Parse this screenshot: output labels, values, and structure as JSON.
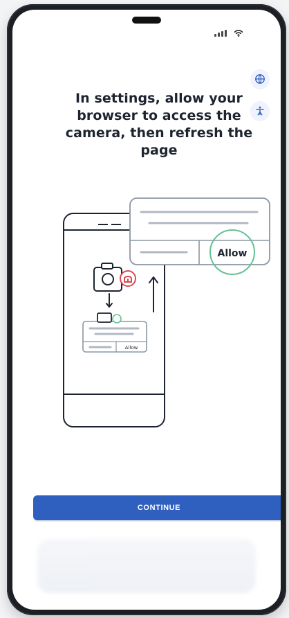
{
  "title": "In settings, allow your browser to access the camera, then refresh the page",
  "dialog": {
    "allow_label": "Allow",
    "small_allow_label": "Allow"
  },
  "primary_button": {
    "label": "CONTINUE"
  },
  "colors": {
    "primary": "#2f5fbf",
    "dialog_border": "#8c96a3",
    "success_ring": "#66c096",
    "danger": "#d64b52",
    "text_dark": "#1d2430",
    "icon_blue": "#2f5fbf"
  },
  "icons": {
    "top_right_1": "globe-icon",
    "top_right_2": "accessibility-icon",
    "status_signal": "signal-icon",
    "status_wifi": "wifi-icon"
  }
}
